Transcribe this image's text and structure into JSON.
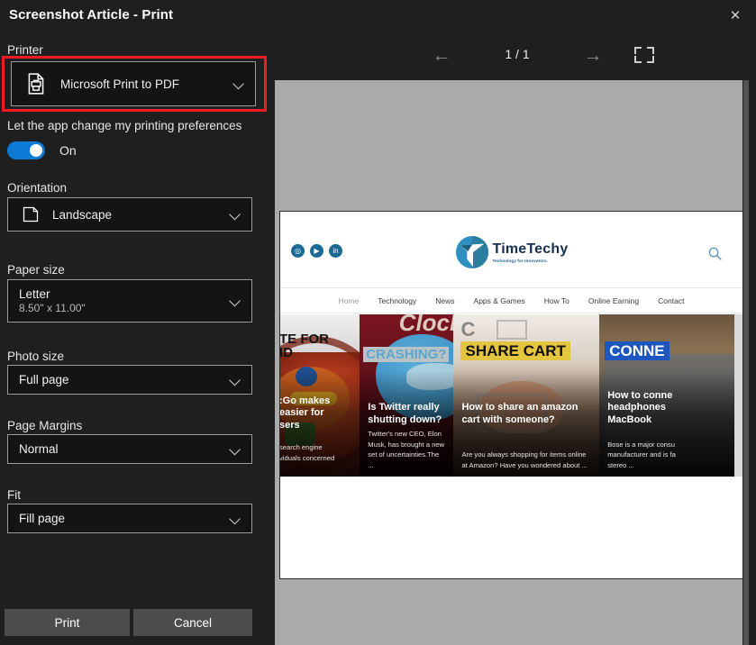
{
  "window": {
    "title": "Screenshot Article - Print",
    "close_icon": "close-icon",
    "close_glyph": "✕"
  },
  "settings": {
    "printer": {
      "label": "Printer",
      "value": "Microsoft Print to PDF",
      "icon": "printer-icon",
      "highlighted": true,
      "highlight_color": "#ee1c25"
    },
    "preferences": {
      "label": "Let the app change my printing preferences",
      "toggle_state": "On",
      "toggle_on": true,
      "accent_color": "#0a7ad4"
    },
    "orientation": {
      "label": "Orientation",
      "value": "Landscape",
      "icon": "page-landscape-icon"
    },
    "paper_size": {
      "label": "Paper size",
      "value": "Letter",
      "dimensions": "8.50\" x 11.00\""
    },
    "photo_size": {
      "label": "Photo size",
      "value": "Full page"
    },
    "page_margins": {
      "label": "Page Margins",
      "value": "Normal"
    },
    "fit": {
      "label": "Fit",
      "value": "Fill page"
    },
    "actions": {
      "print_label": "Print",
      "cancel_label": "Cancel"
    }
  },
  "preview": {
    "prev_glyph": "←",
    "next_glyph": "→",
    "page_indicator": "1 / 1",
    "fullscreen_icon": "fullscreen-icon"
  },
  "page_content": {
    "site": {
      "logo_name": "TimeTechy",
      "logo_tagline": "Technology for Innovators.",
      "search_icon": "magnifier-icon",
      "socials": [
        {
          "name": "instagram-icon",
          "glyph": "◎"
        },
        {
          "name": "youtube-icon",
          "glyph": "▶"
        },
        {
          "name": "linkedin-icon",
          "glyph": "in"
        }
      ],
      "nav": [
        {
          "label": "Home",
          "active": true
        },
        {
          "label": "Technology",
          "active": false
        },
        {
          "label": "News",
          "active": false
        },
        {
          "label": "Apps & Games",
          "active": false
        },
        {
          "label": "How To",
          "active": false
        },
        {
          "label": "Online Earning",
          "active": false
        },
        {
          "label": "Contact",
          "active": false
        }
      ]
    },
    "cards": [
      {
        "banner": "TE FOR\nID",
        "banner_line1": "TE FOR",
        "banner_line2": "ID",
        "title": ":Go makes\neasier for\nsers",
        "title_line1": ":Go makes",
        "title_line2": "easier for",
        "title_line3": "sers",
        "desc_line1": "search engine",
        "desc_line2": "viduals concerned",
        "clipped_left": true
      },
      {
        "banner": "CRASHING?",
        "background_text": "Clock",
        "title": "Is Twitter really shutting down?",
        "desc": "Twitter's new CEO, Elon Musk, has brought a new set of uncertainties.The ..."
      },
      {
        "banner": "SHARE CART",
        "background_text": "C",
        "title": "How to share an amazon cart with someone?",
        "desc": "Are you always shopping for items online at Amazon? Have you wondered about ..."
      },
      {
        "banner": "CONNE",
        "title": "How to conne headphones MacBook",
        "title_line1": "How to conne",
        "title_line2": "headphones",
        "title_line3": "MacBook",
        "desc_line1": "Bose is a major consu",
        "desc_line2": "manufacturer and is fa",
        "desc_line3": "stereo ...",
        "clipped_right": true
      }
    ]
  }
}
